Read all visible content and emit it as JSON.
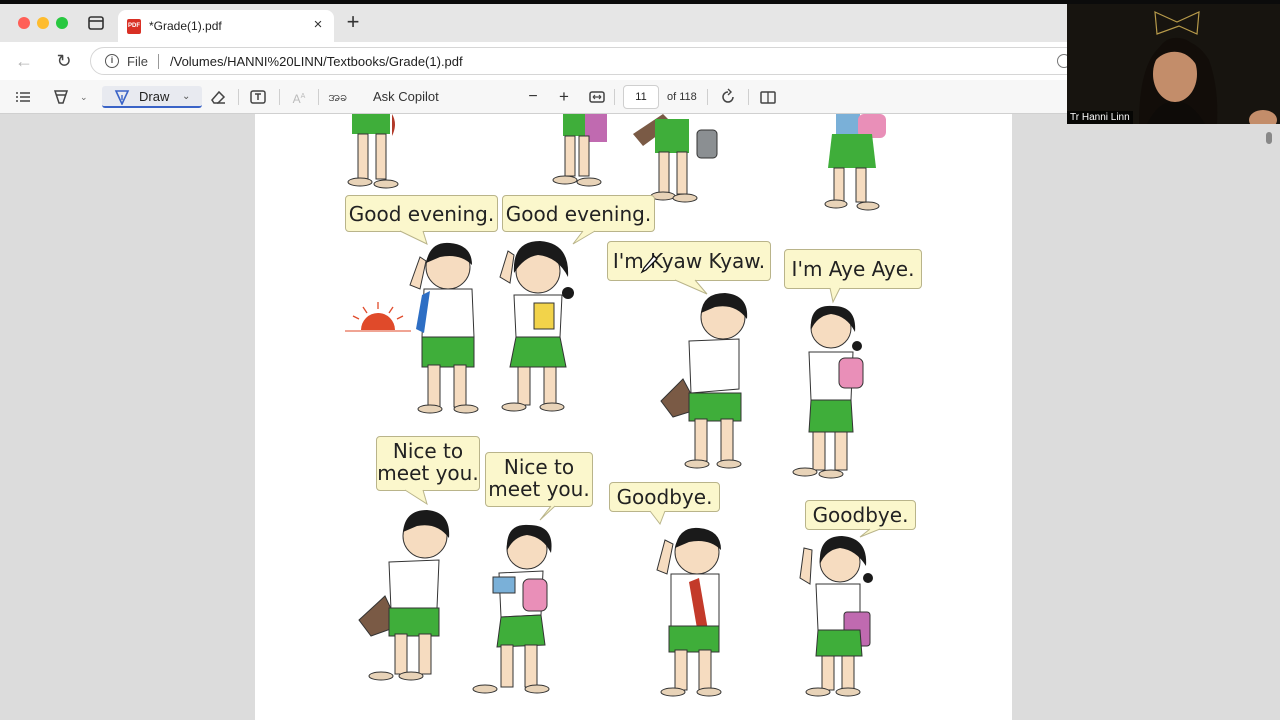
{
  "browser": {
    "tab_title": "*Grade(1).pdf",
    "tab_close": "×",
    "new_tab": "+",
    "address_scheme": "File",
    "address_url": "/Volumes/HANNI%20LINN/Textbooks/Grade(1).pdf"
  },
  "toolbar": {
    "draw_label": "Draw",
    "read_aloud_label": "အခ",
    "copilot_label": "Ask Copilot",
    "zoom_out": "−",
    "zoom_in": "+",
    "page_current": "11",
    "page_total": "of 118"
  },
  "page": {
    "bubbles": {
      "good_evening_1": "Good evening.",
      "good_evening_2": "Good evening.",
      "im_kyaw_kyaw": "I'm Kyaw Kyaw.",
      "im_aye_aye": "I'm Aye Aye.",
      "nice_1_line1": "Nice to",
      "nice_1_line2": "meet you.",
      "nice_2_line1": "Nice to",
      "nice_2_line2": "meet you.",
      "goodbye_1": "Goodbye.",
      "goodbye_2": "Goodbye."
    }
  },
  "video": {
    "participant_name": "Tr Hanni Linn"
  },
  "colors": {
    "bubble_fill": "#fbf7cc",
    "shorts_green": "#3fae3a",
    "skin": "#f6dcc0",
    "hair": "#1a1a1a",
    "draw_accent": "#3a63c7"
  }
}
